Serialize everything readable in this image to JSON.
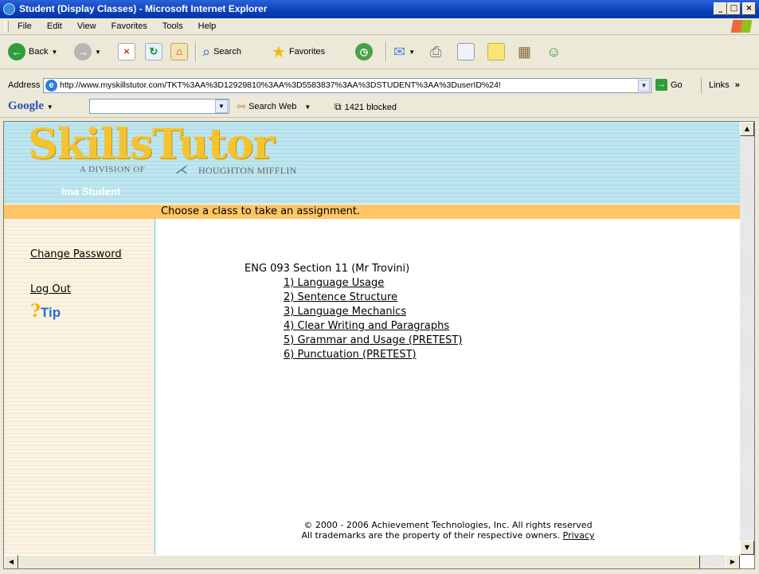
{
  "window": {
    "title": "Student (Display Classes) - Microsoft Internet Explorer",
    "minimize": "_",
    "maximize": "□",
    "close": "×"
  },
  "menu": {
    "items": [
      "File",
      "Edit",
      "View",
      "Favorites",
      "Tools",
      "Help"
    ]
  },
  "toolbar": {
    "back": "Back",
    "search": "Search",
    "favorites": "Favorites"
  },
  "address": {
    "label": "Address",
    "url": "http://www.myskillstutor.com/TKT%3AA%3D12929810%3AA%3D5583837%3AA%3DSTUDENT%3AA%3DuserID%24!",
    "go": "Go",
    "links": "Links"
  },
  "googlebar": {
    "logo": "Google",
    "search_web": "Search Web",
    "blocked": "1421 blocked"
  },
  "header": {
    "logo_text": "SkillsTutor",
    "division": "A DIVISION OF",
    "company": "HOUGHTON MIFFLIN",
    "user": "Ima Student"
  },
  "banner": {
    "text": "Choose a class to take an assignment."
  },
  "sidebar": {
    "change_password": "Change Password",
    "log_out": "Log Out",
    "tip": "Tip"
  },
  "main": {
    "class_title": "ENG 093 Section 11 (Mr Trovini)",
    "assignments": [
      "1) Language Usage",
      "2) Sentence Structure",
      "3) Language Mechanics",
      "4) Clear Writing and Paragraphs",
      "5) Grammar and Usage (PRETEST)",
      "6) Punctuation (PRETEST)"
    ]
  },
  "footer": {
    "copyright": "© 2000 - 2006 Achievement Technologies, Inc. All rights reserved",
    "trademarks": "All trademarks are the property of their respective owners.",
    "privacy": "Privacy"
  },
  "colors": {
    "title_bar": "#0a3fb8",
    "header_blue": "#bfe5ef",
    "banner_orange": "#fdc566",
    "logo_gold": "#f4c430"
  }
}
